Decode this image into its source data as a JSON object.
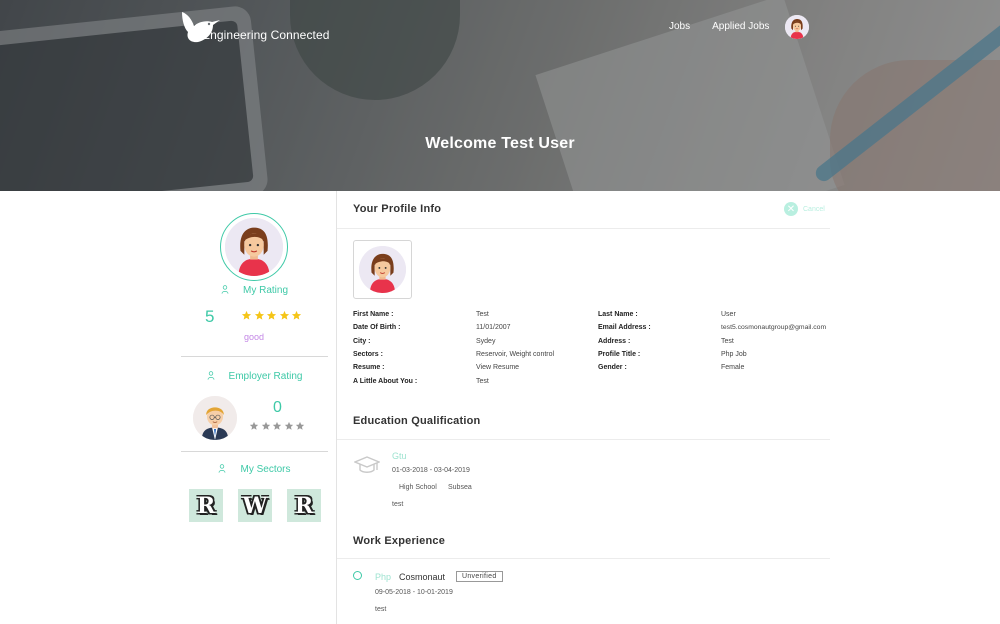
{
  "header": {
    "logo_text": "Engineering Connected",
    "nav": [
      {
        "label": "Jobs"
      },
      {
        "label": "Applied Jobs"
      }
    ],
    "welcome": "Welcome Test User"
  },
  "sidebar": {
    "my_rating_label": "My Rating",
    "my_rating_value": "5",
    "my_rating_stars": 5,
    "my_rating_text": "good",
    "employer_rating_label": "Employer Rating",
    "employer_rating_value": "0",
    "employer_rating_stars": 0,
    "my_sectors_label": "My Sectors",
    "sectors": [
      "R",
      "W",
      "R"
    ]
  },
  "profile": {
    "title": "Your Profile Info",
    "cancel_label": "Cancel",
    "fields_left": [
      {
        "label": "First Name :",
        "value": "Test"
      },
      {
        "label": "Date Of Birth :",
        "value": "11/01/2007"
      },
      {
        "label": "City :",
        "value": "Sydey"
      },
      {
        "label": "Sectors :",
        "value": "Reservoir, Weight control"
      },
      {
        "label": "Resume :",
        "value": "View Resume"
      },
      {
        "label": "A Little About You :",
        "value": "Test"
      }
    ],
    "fields_right": [
      {
        "label": "Last Name :",
        "value": "User"
      },
      {
        "label": "Email Address :",
        "value": "test5.cosmonautgroup@gmail.com"
      },
      {
        "label": "Address :",
        "value": "Test"
      },
      {
        "label": "Profile Title :",
        "value": "Php Job"
      },
      {
        "label": "Gender :",
        "value": "Female"
      }
    ]
  },
  "education": {
    "title": "Education Qualification",
    "items": [
      {
        "name": "Gtu",
        "dates": "01-03-2018 - 03-04-2019",
        "tags": [
          "High School",
          "Subsea"
        ],
        "description": "test"
      }
    ]
  },
  "work": {
    "title": "Work Experience",
    "items": [
      {
        "title": "Php",
        "company": "Cosmonaut",
        "status": "Unverified",
        "dates": "09-05-2018 - 10-01-2019",
        "description": "test"
      }
    ]
  },
  "colors": {
    "accent": "#3ec9a7",
    "accent_light": "#9ee3d0",
    "star": "#f5c518",
    "star_empty": "#999999",
    "good_text": "#c488e6",
    "sector_tile": "#cfe8dc"
  },
  "icons": [
    "hummingbird-logo-icon",
    "person-icon",
    "star-icon",
    "graduation-cap-icon",
    "close-icon"
  ]
}
